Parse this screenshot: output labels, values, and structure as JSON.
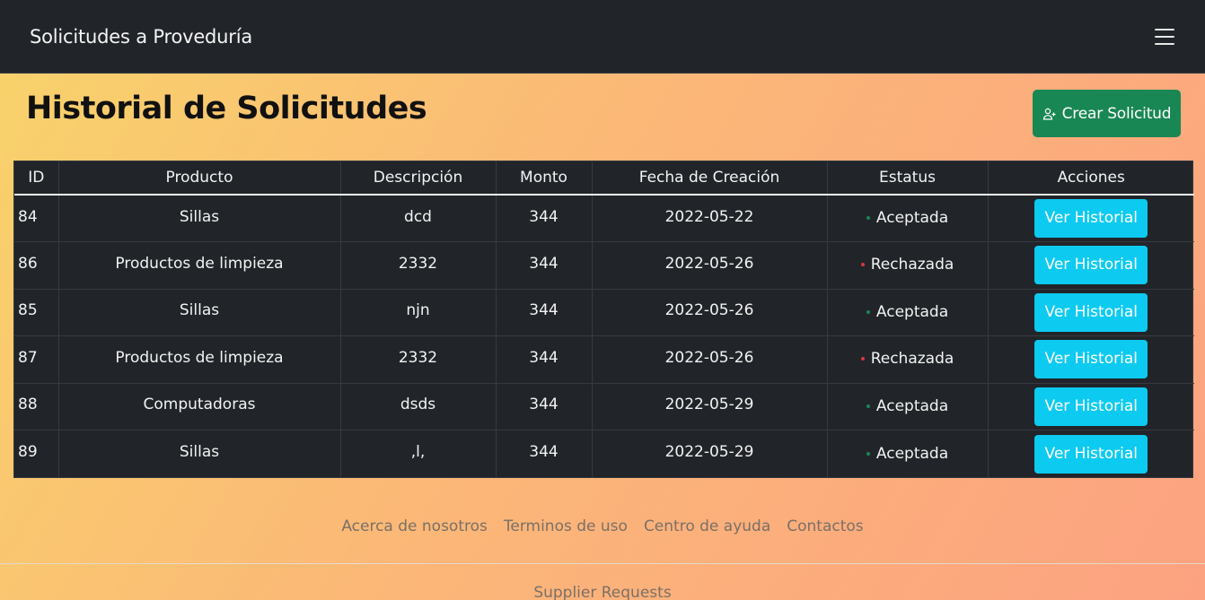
{
  "navbar": {
    "brand": "Solicitudes a Proveduría"
  },
  "header": {
    "title": "Historial de Solicitudes",
    "create_button": "Crear Solicitud"
  },
  "table": {
    "columns": [
      "ID",
      "Producto",
      "Descripción",
      "Monto",
      "Fecha de Creación",
      "Estatus",
      "Acciones"
    ],
    "rows": [
      {
        "id": "84",
        "producto": "Sillas",
        "descripcion": "dcd",
        "monto": "344",
        "fecha": "2022-05-22",
        "estatus": "Aceptada",
        "accion": "Ver Historial"
      },
      {
        "id": "86",
        "producto": "Productos de limpieza",
        "descripcion": "2332",
        "monto": "344",
        "fecha": "2022-05-26",
        "estatus": "Rechazada",
        "accion": "Ver Historial"
      },
      {
        "id": "85",
        "producto": "Sillas",
        "descripcion": "njn",
        "monto": "344",
        "fecha": "2022-05-26",
        "estatus": "Aceptada",
        "accion": "Ver Historial"
      },
      {
        "id": "87",
        "producto": "Productos de limpieza",
        "descripcion": "2332",
        "monto": "344",
        "fecha": "2022-05-26",
        "estatus": "Rechazada",
        "accion": "Ver Historial"
      },
      {
        "id": "88",
        "producto": "Computadoras",
        "descripcion": "dsds",
        "monto": "344",
        "fecha": "2022-05-29",
        "estatus": "Aceptada",
        "accion": "Ver Historial"
      },
      {
        "id": "89",
        "producto": "Sillas",
        "descripcion": ",l,",
        "monto": "344",
        "fecha": "2022-05-29",
        "estatus": "Aceptada",
        "accion": "Ver Historial"
      }
    ]
  },
  "status_colors": {
    "Aceptada": "#198754",
    "Rechazada": "#dc3545"
  },
  "footer": {
    "links": [
      "Acerca de nosotros",
      "Terminos de uso",
      "Centro de ayuda",
      "Contactos"
    ],
    "brand": "Supplier Requests"
  },
  "icons": {
    "create": "person-add-icon",
    "menu": "hamburger-menu-icon"
  }
}
